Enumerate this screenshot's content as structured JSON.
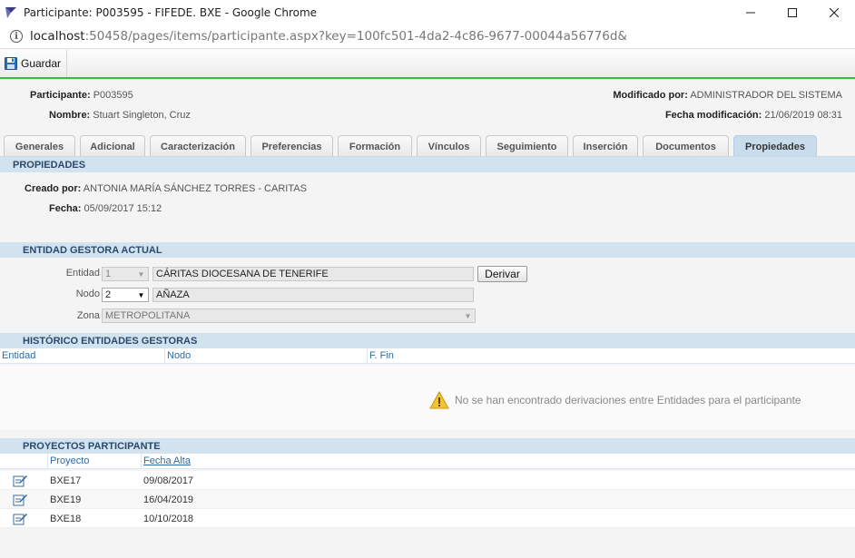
{
  "window": {
    "title": "Participante: P003595 - FIFEDE. BXE - Google Chrome",
    "url_host": "localhost",
    "url_rest": ":50458/pages/items/participante.aspx?key=100fc501-4da2-4c86-9677-00044a56776d&"
  },
  "toolbar": {
    "save_label": "Guardar"
  },
  "header": {
    "participante_label": "Participante:",
    "participante_value": "P003595",
    "nombre_label": "Nombre:",
    "nombre_value": "Stuart Singleton, Cruz",
    "modificado_label": "Modificado por:",
    "modificado_value": "ADMINISTRADOR DEL SISTEMA",
    "fecha_mod_label": "Fecha modificación:",
    "fecha_mod_value": "21/06/2019 08:31"
  },
  "tabs": [
    "Generales",
    "Adicional",
    "Caracterización",
    "Preferencias",
    "Formación",
    "Vínculos",
    "Seguimiento",
    "Inserción",
    "Documentos",
    "Propiedades"
  ],
  "propiedades": {
    "title": "PROPIEDADES",
    "creado_label": "Creado por:",
    "creado_value": "ANTONIA MARÍA SÁNCHEZ TORRES - CARITAS",
    "fecha_label": "Fecha:",
    "fecha_value": "05/09/2017 15:12"
  },
  "entidad_gestora": {
    "title": "ENTIDAD GESTORA ACTUAL",
    "entidad_label": "Entidad",
    "entidad_code": "1",
    "entidad_name": "CÁRITAS DIOCESANA DE TENERIFE",
    "derivar_label": "Derivar",
    "nodo_label": "Nodo",
    "nodo_code": "2",
    "nodo_name": "AÑAZA",
    "zona_label": "Zona",
    "zona_value": "METROPOLITANA"
  },
  "historico": {
    "title": "HISTÓRICO ENTIDADES GESTORAS",
    "columns": [
      "Entidad",
      "Nodo",
      "F. Fin"
    ],
    "empty_message": "No se han encontrado derivaciones entre Entidades para el participante"
  },
  "proyectos": {
    "title": "PROYECTOS PARTICIPANTE",
    "columns": [
      "Proyecto",
      "Fecha Alta"
    ],
    "rows": [
      {
        "proyecto": "BXE17",
        "fecha": "09/08/2017"
      },
      {
        "proyecto": "BXE19",
        "fecha": "16/04/2019"
      },
      {
        "proyecto": "BXE18",
        "fecha": "10/10/2018"
      }
    ]
  },
  "icons": {
    "app": "app-logo-icon",
    "info": "info-icon",
    "save": "floppy-disk-icon",
    "warning": "warning-icon",
    "edit": "edit-icon"
  },
  "colors": {
    "accent_line": "#3dbb3d",
    "section_bar": "#d3e2ef",
    "active_tab": "#c9dced",
    "link_blue": "#2a6ba8"
  }
}
